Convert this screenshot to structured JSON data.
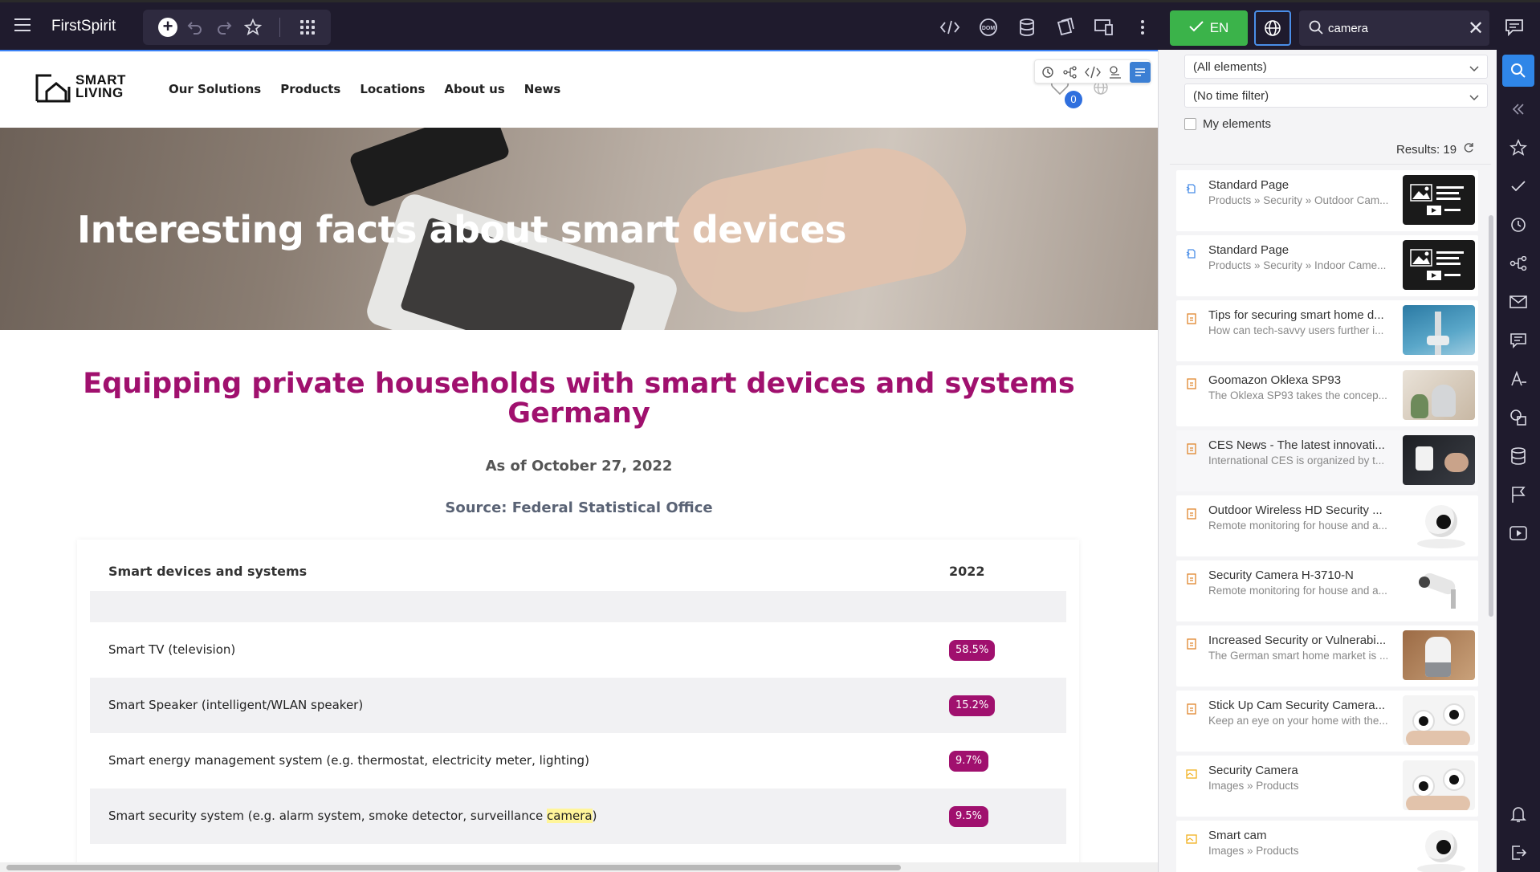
{
  "app": {
    "brand": "FirstSpirit",
    "language_label": "EN",
    "search_value": "camera",
    "search_placeholder": "Search"
  },
  "site": {
    "logo_line1": "SMART",
    "logo_line2": "LIVING",
    "nav": [
      "Our Solutions",
      "Products",
      "Locations",
      "About us",
      "News"
    ],
    "cart_count": "0",
    "hero_title": "Interesting facts about smart devices",
    "content_title": "Equipping private households with smart devices and systems Germany",
    "as_of": "As of October 27, 2022",
    "source": "Source: Federal Statistical Office",
    "table": {
      "col1": "Smart devices and systems",
      "col2": "2022",
      "rows": [
        {
          "label": "Smart TV (television)",
          "value": "58.5%"
        },
        {
          "label": "Smart Speaker (intelligent/WLAN speaker)",
          "value": "15.2%"
        },
        {
          "label": "Smart energy management system (e.g. thermostat, electricity meter, lighting)",
          "value": "9.7%"
        },
        {
          "label_pre": "Smart security system (e.g. alarm system, smoke detector, surveillance ",
          "label_hl": "camera",
          "label_post": ")",
          "value": "9.5%"
        }
      ]
    }
  },
  "panel": {
    "filter_elements": "(All elements)",
    "filter_time": "(No time filter)",
    "my_elements": "My elements",
    "results": "Results: 19",
    "items": [
      {
        "title": "Standard Page",
        "sub": "Products » Security » Outdoor Cam...",
        "kind": "page",
        "thumb": "template"
      },
      {
        "title": "Standard Page",
        "sub": "Products » Security » Indoor Came...",
        "kind": "page",
        "thumb": "template"
      },
      {
        "title": "Tips for securing smart home d...",
        "sub": "How can tech-savvy users further i...",
        "kind": "dataset",
        "thumb": "pole"
      },
      {
        "title": "Goomazon Oklexa SP93",
        "sub": "The Oklexa SP93 takes the concep...",
        "kind": "dataset",
        "thumb": "speaker"
      },
      {
        "title": "CES News - The latest innovati...",
        "sub": "International CES is organized by t...",
        "kind": "dataset",
        "thumb": "dark-cam"
      },
      {
        "title": "Outdoor Wireless HD Security ...",
        "sub": "Remote monitoring for house and a...",
        "kind": "dataset",
        "thumb": "white-cam"
      },
      {
        "title": "Security Camera H-3710-N",
        "sub": "Remote monitoring for house and a...",
        "kind": "dataset",
        "thumb": "bullet-cam"
      },
      {
        "title": "Increased Security or Vulnerabi...",
        "sub": "The German smart home market is ...",
        "kind": "dataset",
        "thumb": "home-speaker"
      },
      {
        "title": "Stick Up Cam Security Camera...",
        "sub": "Keep an eye on your home with the...",
        "kind": "dataset",
        "thumb": "hand-cam"
      },
      {
        "title": "Security Camera",
        "sub": "Images » Products",
        "kind": "media",
        "thumb": "hand-cam"
      },
      {
        "title": "Smart cam",
        "sub": "Images » Products",
        "kind": "media",
        "thumb": "white-cam"
      }
    ]
  },
  "colors": {
    "topbar": "#1f1b2d",
    "accent_magenta": "#a0106e",
    "lang_green": "#3bb34a",
    "active_blue": "#2f86e8"
  }
}
